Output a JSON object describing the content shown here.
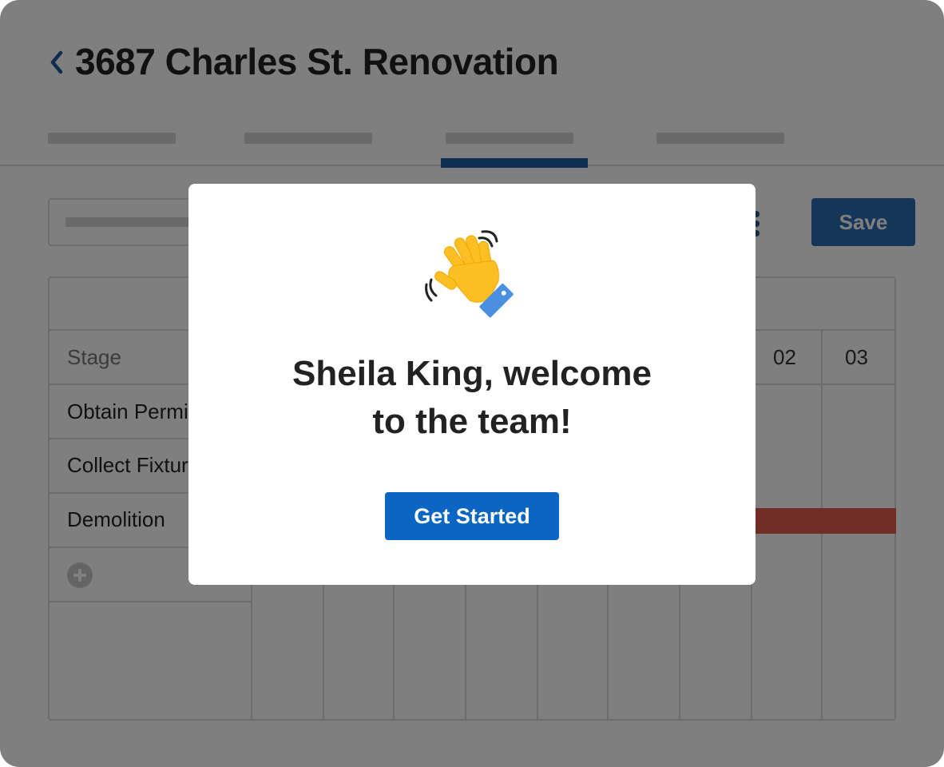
{
  "project": {
    "title": "3687 Charles St. Renovation"
  },
  "toolbar": {
    "save_label": "Save"
  },
  "gantt": {
    "stage_header": "Stage",
    "stages": [
      "Obtain Permits",
      "Collect Fixtures",
      "Demolition"
    ],
    "day_labels": [
      "02",
      "03"
    ]
  },
  "modal": {
    "title_line1": "Sheila King, welcome",
    "title_line2": "to the team!",
    "cta_label": "Get Started"
  },
  "colors": {
    "accent": "#0a66c2",
    "save_button": "#2c6db3",
    "tab_indicator": "#1f5d9e",
    "task_bar": "#e25d4e",
    "hand": "#fbbf24",
    "cuff": "#4a90e2"
  }
}
